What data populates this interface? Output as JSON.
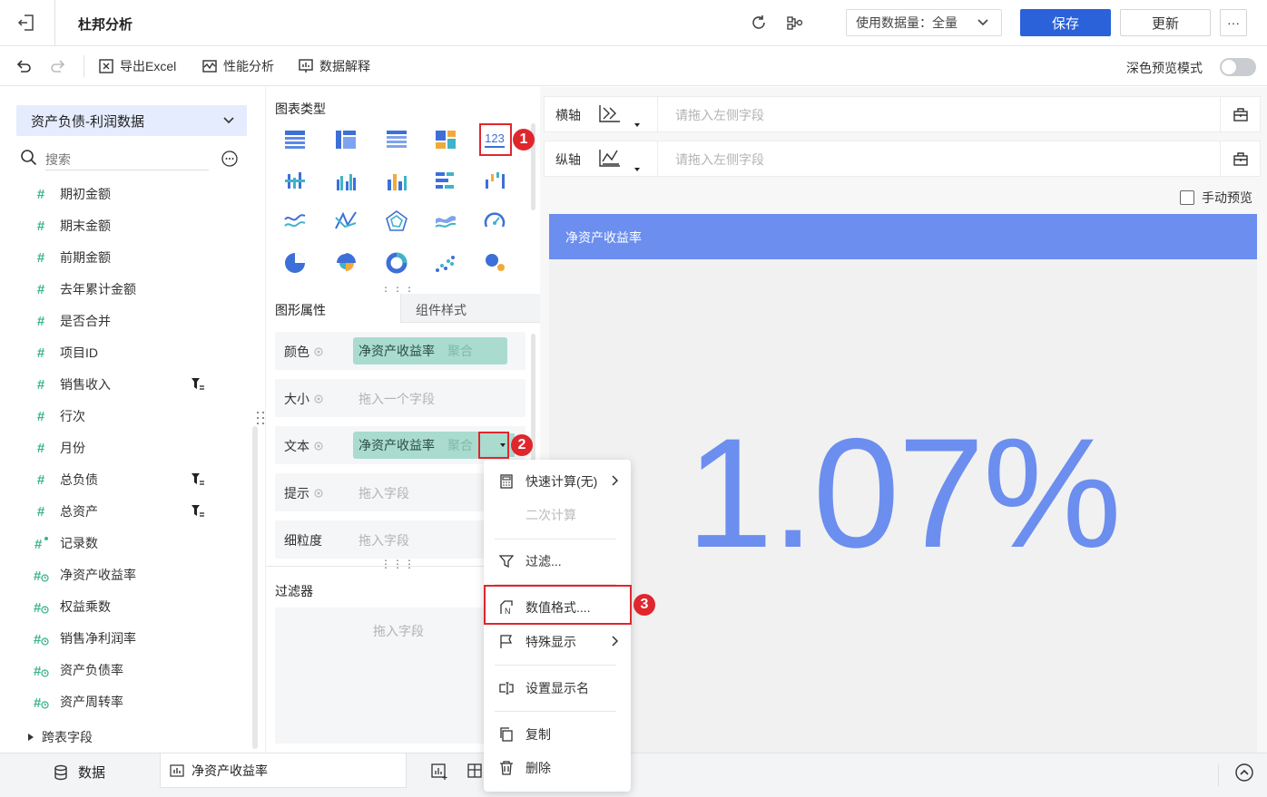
{
  "header": {
    "title": "杜邦分析",
    "data_amount_label": "使用数据量：全量",
    "save_label": "保存",
    "update_label": "更新",
    "more_label": "···"
  },
  "toolbar": {
    "export_excel": "导出Excel",
    "perf_analysis": "性能分析",
    "data_explain": "数据解释",
    "dark_preview": "深色预览模式"
  },
  "left": {
    "dataset": "资产负债-利润数据",
    "search_placeholder": "搜索",
    "fields": [
      {
        "name": "期初金额",
        "type": "number"
      },
      {
        "name": "期末金额",
        "type": "number"
      },
      {
        "name": "前期金额",
        "type": "number"
      },
      {
        "name": "去年累计金额",
        "type": "number"
      },
      {
        "name": "是否合并",
        "type": "number"
      },
      {
        "name": "项目ID",
        "type": "number"
      },
      {
        "name": "销售收入",
        "type": "number",
        "filtered": true
      },
      {
        "name": "行次",
        "type": "number"
      },
      {
        "name": "月份",
        "type": "number"
      },
      {
        "name": "总负债",
        "type": "number",
        "filtered": true
      },
      {
        "name": "总资产",
        "type": "number",
        "filtered": true
      },
      {
        "name": "记录数",
        "type": "count"
      },
      {
        "name": "净资产收益率",
        "type": "calc"
      },
      {
        "name": "权益乘数",
        "type": "calc"
      },
      {
        "name": "销售净利润率",
        "type": "calc"
      },
      {
        "name": "资产负债率",
        "type": "calc"
      },
      {
        "name": "资产周转率",
        "type": "calc"
      }
    ],
    "cross_table": "跨表字段"
  },
  "middle": {
    "chart_type_title": "图表类型",
    "chart_type_selected": "123",
    "tab_graphic": "图形属性",
    "tab_style": "组件样式",
    "props": {
      "color_label": "颜色",
      "color_field": "净资产收益率",
      "color_agg": "聚合",
      "size_label": "大小",
      "size_placeholder": "拖入一个字段",
      "text_label": "文本",
      "text_field": "净资产收益率",
      "text_agg": "聚合",
      "tip_label": "提示",
      "tip_placeholder": "拖入字段",
      "gran_label": "细粒度",
      "gran_placeholder": "拖入字段"
    },
    "filter_title": "过滤器",
    "filter_placeholder": "拖入字段"
  },
  "right": {
    "x_axis_label": "横轴",
    "x_axis_placeholder": "请拖入左侧字段",
    "y_axis_label": "纵轴",
    "y_axis_placeholder": "请拖入左侧字段",
    "manual_preview": "手动预览",
    "kpi_title": "净资产收益率",
    "kpi_value": "1.07%",
    "kpi_color": "#6b8eef"
  },
  "menu": {
    "quick_calc": "快速计算(无)",
    "second_calc": "二次计算",
    "filter": "过滤...",
    "number_format": "数值格式....",
    "special_display": "特殊显示",
    "set_display_name": "设置显示名",
    "copy": "复制",
    "delete": "删除"
  },
  "bottom": {
    "data_tab": "数据",
    "component_tab": "净资产收益率"
  },
  "annotations": [
    "1",
    "2",
    "3"
  ]
}
